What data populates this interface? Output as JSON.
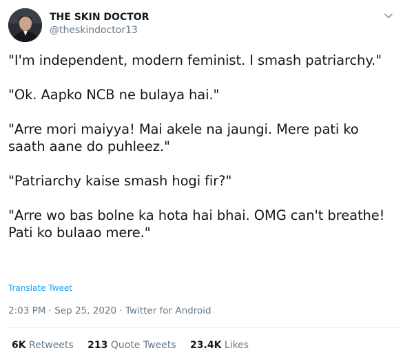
{
  "author": {
    "display_name": "THE SKIN DOCTOR",
    "handle": "@theskindoctor13"
  },
  "tweet": {
    "paragraphs": [
      "\"I'm independent, modern feminist. I smash patriarchy.\"",
      "\"Ok. Aapko NCB ne bulaya hai.\"",
      "\"Arre mori maiyya! Mai akele na jaungi. Mere pati ko saath aane do puhleez.\"",
      "\"Patriarchy kaise smash hogi fir?\"",
      "\"Arre wo bas bolne ka hota hai bhai. OMG can't breathe! Pati ko bulaao mere.\""
    ],
    "translate_label": "Translate Tweet",
    "timestamp": "2:03 PM · Sep 25, 2020 · Twitter for Android"
  },
  "stats": {
    "retweets_count": "6K",
    "retweets_label": "Retweets",
    "quote_tweets_count": "213",
    "quote_tweets_label": "Quote Tweets",
    "likes_count": "23.4K",
    "likes_label": "Likes"
  },
  "icons": {
    "menu_caret": "chevron-down-icon",
    "avatar": "profile-avatar"
  },
  "colors": {
    "link": "#1da1f2",
    "text_primary": "#14171a",
    "text_secondary": "#657786",
    "divider": "#e6ecf0"
  }
}
